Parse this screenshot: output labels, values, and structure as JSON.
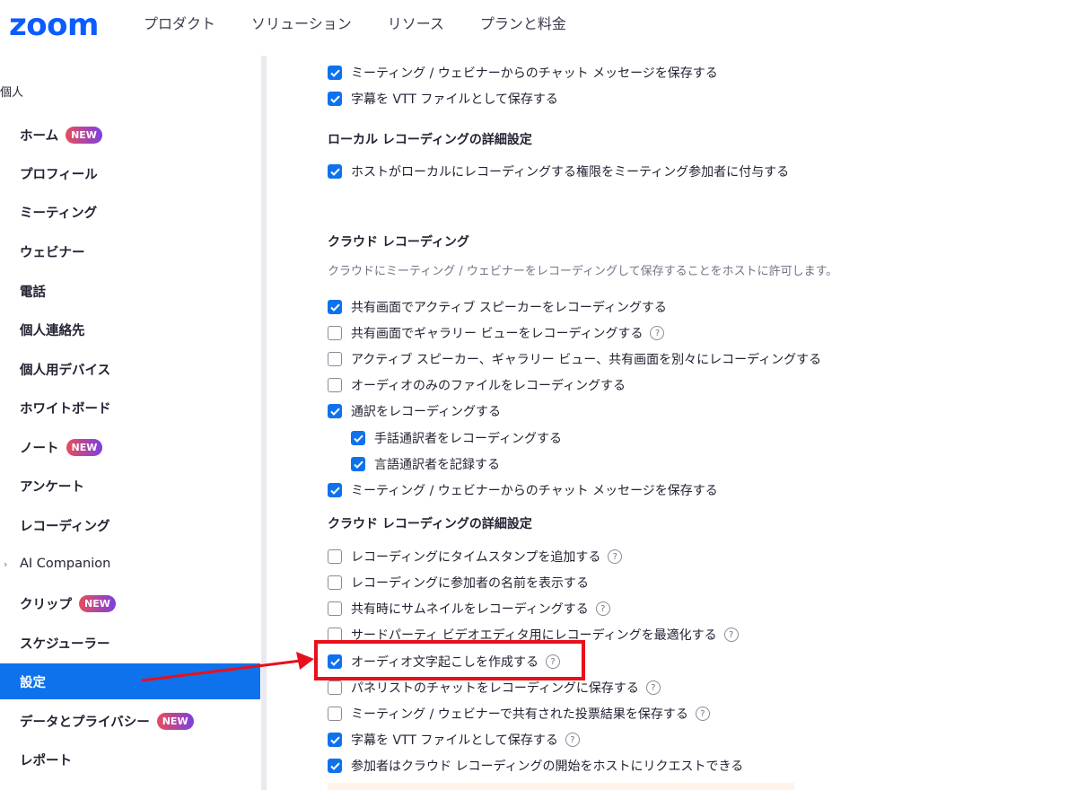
{
  "header": {
    "logo": "zoom",
    "nav": [
      "プロダクト",
      "ソリューション",
      "リソース",
      "プランと料金"
    ]
  },
  "sidebar": {
    "section": "個人",
    "items": [
      {
        "label": "ホーム",
        "badge": "NEW"
      },
      {
        "label": "プロフィール"
      },
      {
        "label": "ミーティング"
      },
      {
        "label": "ウェビナー"
      },
      {
        "label": "電話"
      },
      {
        "label": "個人連絡先"
      },
      {
        "label": "個人用デバイス"
      },
      {
        "label": "ホワイトボード"
      },
      {
        "label": "ノート",
        "badge": "NEW"
      },
      {
        "label": "アンケート"
      },
      {
        "label": "レコーディング"
      },
      {
        "label": "AI Companion",
        "chevron": "›"
      },
      {
        "label": "クリップ",
        "badge": "NEW"
      },
      {
        "label": "スケジューラー"
      },
      {
        "label": "設定",
        "active": true
      },
      {
        "label": "データとプライバシー",
        "badge": "NEW"
      },
      {
        "label": "レポート"
      }
    ]
  },
  "content": {
    "top_options": [
      {
        "label": "ミーティング / ウェビナーからのチャット メッセージを保存する",
        "checked": true
      },
      {
        "label": "字幕を VTT ファイルとして保存する",
        "checked": true
      }
    ],
    "local_advanced_heading": "ローカル レコーディングの詳細設定",
    "local_advanced_options": [
      {
        "label": "ホストがローカルにレコーディングする権限をミーティング参加者に付与する",
        "checked": true
      }
    ],
    "cloud_heading": "クラウド レコーディング",
    "cloud_description": "クラウドにミーティング / ウェビナーをレコーディングして保存することをホストに許可します。",
    "cloud_options": [
      {
        "label": "共有画面でアクティブ スピーカーをレコーディングする",
        "checked": true
      },
      {
        "label": "共有画面でギャラリー ビューをレコーディングする",
        "checked": false,
        "help": true
      },
      {
        "label": "アクティブ スピーカー、ギャラリー ビュー、共有画面を別々にレコーディングする",
        "checked": false
      },
      {
        "label": "オーディオのみのファイルをレコーディングする",
        "checked": false
      },
      {
        "label": "通訳をレコーディングする",
        "checked": true
      },
      {
        "label": "手話通訳者をレコーディングする",
        "checked": true,
        "indent": true
      },
      {
        "label": "言語通訳者を記録する",
        "checked": true,
        "indent": true
      },
      {
        "label": "ミーティング / ウェビナーからのチャット メッセージを保存する",
        "checked": true
      }
    ],
    "cloud_advanced_heading": "クラウド レコーディングの詳細設定",
    "cloud_advanced_options": [
      {
        "label": "レコーディングにタイムスタンプを追加する",
        "checked": false,
        "help": true
      },
      {
        "label": "レコーディングに参加者の名前を表示する",
        "checked": false
      },
      {
        "label": "共有時にサムネイルをレコーディングする",
        "checked": false,
        "help": true
      },
      {
        "label": "サードパーティ ビデオエディタ用にレコーディングを最適化する",
        "checked": false,
        "help": true
      },
      {
        "label": "オーディオ文字起こしを作成する",
        "checked": true,
        "help": true
      },
      {
        "label": "パネリストのチャットをレコーディングに保存する",
        "checked": false,
        "help": true
      },
      {
        "label": "ミーティング / ウェビナーで共有された投票結果を保存する",
        "checked": false,
        "help": true
      },
      {
        "label": "字幕を VTT ファイルとして保存する",
        "checked": true,
        "help": true
      },
      {
        "label": "参加者はクラウド レコーディングの開始をホストにリクエストできる",
        "checked": true
      }
    ]
  },
  "colors": {
    "brand": "#0b5cff",
    "active_bg": "#0e72ed",
    "checkbox_on": "#0e72ed",
    "annotation": "#e8101b"
  }
}
